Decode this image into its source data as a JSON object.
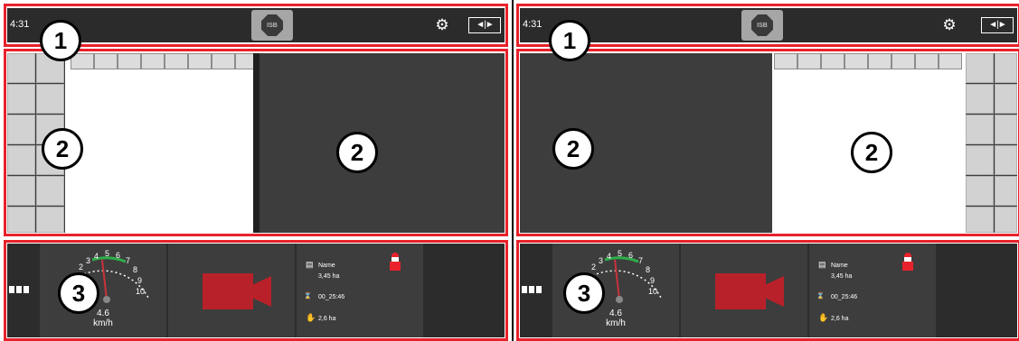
{
  "status_bar": {
    "time": "4:31",
    "isb_label": "ISB",
    "settings_icon": "gear-icon",
    "swap_icon": "swap-screens-icon",
    "swap_glyph": "◄|►"
  },
  "callouts": {
    "one": "1",
    "two": "2",
    "three": "3"
  },
  "speedometer": {
    "speed": "4.6",
    "unit": "km/h",
    "scale_labels": [
      "2",
      "3",
      "4",
      "5",
      "6",
      "7",
      "8",
      "9",
      "10"
    ],
    "needle_value": 4.6
  },
  "work_info": {
    "name": "Name",
    "area_total": "3,45 ha",
    "time": "00_25:46",
    "area_worked": "2,6 ha"
  },
  "colors": {
    "accent_red": "#e8212b",
    "camera_red": "#b8212a",
    "panel_dark": "#3d3d3d",
    "bar_dark": "#2b2b2b"
  }
}
